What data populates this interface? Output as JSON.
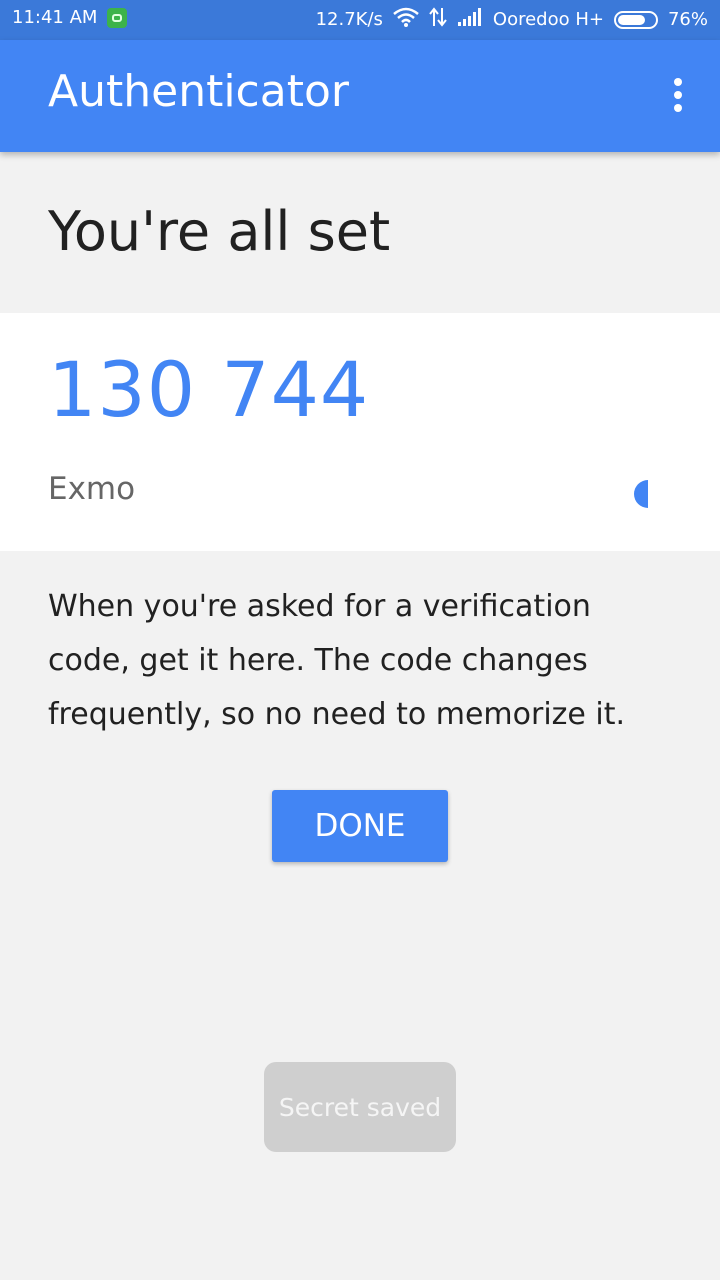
{
  "status_bar": {
    "time": "11:41 AM",
    "speed": "12.7K/s",
    "carrier": "Ooredoo H+",
    "battery": "76%",
    "battery_level": 0.76
  },
  "app_bar": {
    "title": "Authenticator",
    "menu_icon": "more-vert-icon"
  },
  "main": {
    "headline": "You're all set",
    "code": "130 744",
    "account": "Exmo",
    "timer_icon": "countdown-pie-icon",
    "description": "When you're asked for a verification code, get it here. The code changes frequently, so no need to memorize it.",
    "done_label": "DONE"
  },
  "toast": {
    "text": "Secret saved"
  },
  "colors": {
    "accent": "#4285f4",
    "status_bar": "#3b79d9",
    "background": "#f2f2f2"
  }
}
